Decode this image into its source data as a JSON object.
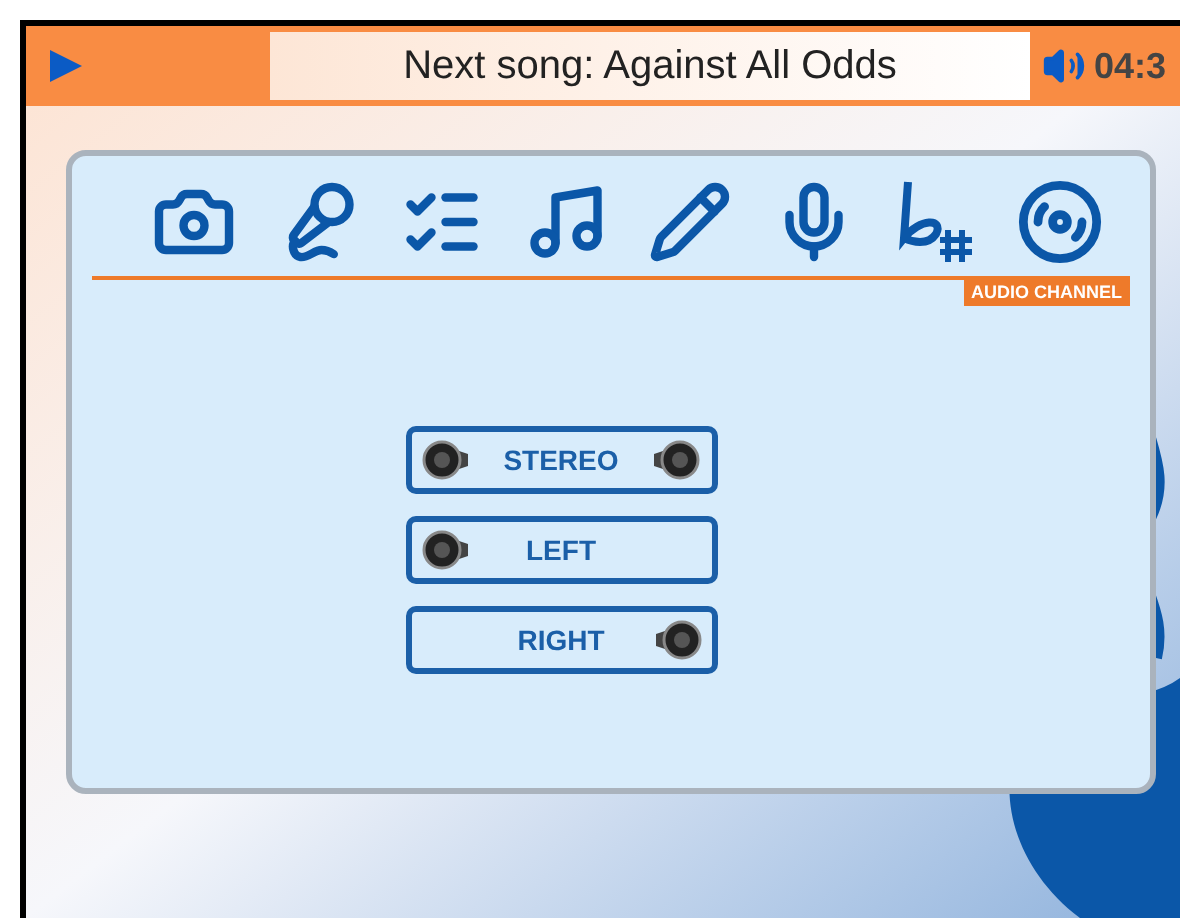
{
  "header": {
    "next_song": "Next song: Against All Odds",
    "time": "04:3"
  },
  "toolbar": {
    "section_label": "AUDIO CHANNEL"
  },
  "channels": [
    {
      "label": "STEREO",
      "kind": "both"
    },
    {
      "label": "LEFT",
      "kind": "left"
    },
    {
      "label": "RIGHT",
      "kind": "right"
    }
  ]
}
